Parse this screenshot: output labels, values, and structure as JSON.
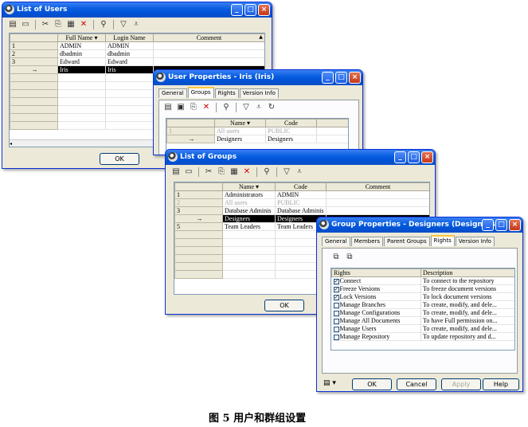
{
  "list_users": {
    "title": "List of Users",
    "columns": [
      "Full Name",
      "Login Name",
      "Comment"
    ],
    "rows": [
      {
        "num": "1",
        "full": "ADMIN",
        "login": "ADMIN",
        "comment": ""
      },
      {
        "num": "2",
        "full": "dbadmin",
        "login": "dbadmin",
        "comment": ""
      },
      {
        "num": "3",
        "full": "Edward",
        "login": "Edward",
        "comment": ""
      },
      {
        "num": "→",
        "full": "Iris",
        "login": "Iris",
        "comment": ""
      }
    ],
    "ok_label": "OK"
  },
  "user_props": {
    "title": "User Properties - Iris (Iris)",
    "tabs": [
      "General",
      "Groups",
      "Rights",
      "Version Info"
    ],
    "columns": [
      "Name",
      "Code"
    ],
    "rows": [
      {
        "num": "1",
        "name": "All users",
        "code": "PUBLIC"
      },
      {
        "num": "→",
        "name": "Designers",
        "code": "Designers"
      }
    ]
  },
  "list_groups": {
    "title": "List of Groups",
    "columns": [
      "Name",
      "Code",
      "Comment"
    ],
    "rows": [
      {
        "num": "1",
        "name": "Administrators",
        "code": "ADMIN"
      },
      {
        "num": "2",
        "name": "All users",
        "code": "PUBLIC"
      },
      {
        "num": "3",
        "name": "Database Adminis",
        "code": "Database Adminis"
      },
      {
        "num": "→",
        "name": "Designers",
        "code": "Designers"
      },
      {
        "num": "5",
        "name": "Team Leaders",
        "code": "Team Leaders"
      }
    ],
    "ok_label": "OK"
  },
  "group_props": {
    "title": "Group Properties - Designers (Designers)",
    "tabs": [
      "General",
      "Members",
      "Parent Groups",
      "Rights",
      "Version Info"
    ],
    "columns": [
      "Rights",
      "Description"
    ],
    "rights": [
      {
        "name": "Connect",
        "desc": "To connect to the repository",
        "checked": true
      },
      {
        "name": "Freeze Versions",
        "desc": "To freeze document versions",
        "checked": true
      },
      {
        "name": "Lock Versions",
        "desc": "To lock document versions",
        "checked": true
      },
      {
        "name": "Manage Branches",
        "desc": "To create, modify, and dele...",
        "checked": false
      },
      {
        "name": "Manage Configurations",
        "desc": "To create, modify, and dele...",
        "checked": false
      },
      {
        "name": "Manage All Documents",
        "desc": "To have Full permission on...",
        "checked": false
      },
      {
        "name": "Manage Users",
        "desc": "To create, modify, and dele...",
        "checked": false
      },
      {
        "name": "Manage Repository",
        "desc": "To update repository and d...",
        "checked": false
      }
    ],
    "buttons": {
      "ok": "OK",
      "cancel": "Cancel",
      "apply": "Apply",
      "help": "Help"
    }
  },
  "caption": "图 5 用户和群组设置",
  "colors": {
    "titlebar": "#0a5ee0",
    "window_bg": "#ece9d8",
    "selected_row": "#000000"
  }
}
